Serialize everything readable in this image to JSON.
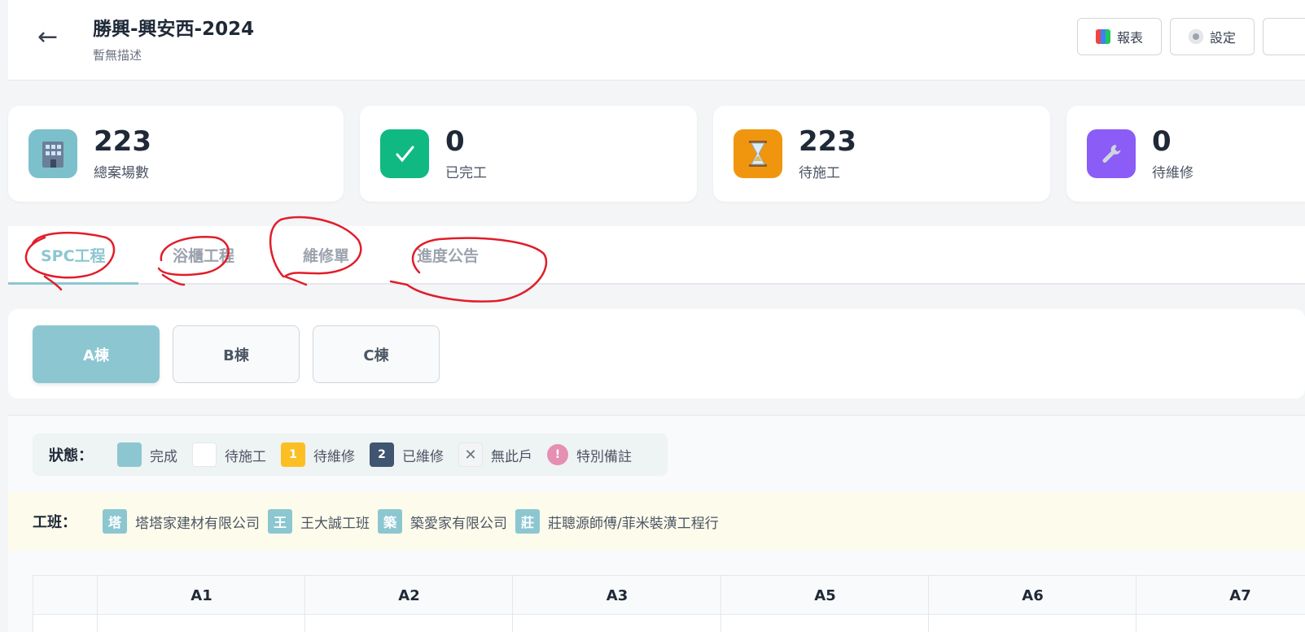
{
  "header": {
    "back_icon": "←",
    "title": "勝興-興安西-2024",
    "subtitle": "暫無描述",
    "buttons": [
      {
        "label": "報表",
        "icon": "report-icon"
      },
      {
        "label": "設定",
        "icon": "gear-icon"
      }
    ]
  },
  "stats": [
    {
      "value": "223",
      "label": "總案場數",
      "icon": "building-icon",
      "color": "#7cc0cb"
    },
    {
      "value": "0",
      "label": "已完工",
      "icon": "check-icon",
      "color": "#10b981"
    },
    {
      "value": "223",
      "label": "待施工",
      "icon": "hourglass-icon",
      "color": "#f59e0b"
    },
    {
      "value": "0",
      "label": "待維修",
      "icon": "wrench-icon",
      "color": "#8b5cf6"
    }
  ],
  "tabs": [
    {
      "label": "SPC工程",
      "active": true
    },
    {
      "label": "浴櫃工程",
      "active": false
    },
    {
      "label": "維修單",
      "active": false
    },
    {
      "label": "進度公告",
      "active": false
    }
  ],
  "buildings": [
    {
      "label": "A棟",
      "active": true
    },
    {
      "label": "B棟",
      "active": false
    },
    {
      "label": "C棟",
      "active": false
    }
  ],
  "legend": {
    "title": "狀態：",
    "items": [
      {
        "label": "完成",
        "color": "#8cc7d1",
        "mark": ""
      },
      {
        "label": "待施工",
        "color": "#ffffff",
        "mark": ""
      },
      {
        "label": "待維修",
        "color": "#fbbf24",
        "mark": "1"
      },
      {
        "label": "已維修",
        "color": "#3f5570",
        "mark": "2"
      },
      {
        "label": "無此戶",
        "color": "#f3f4f6",
        "mark": "✕"
      },
      {
        "label": "特別備註",
        "color": "#e58fb2",
        "mark": "!"
      }
    ]
  },
  "teams": {
    "title": "工班：",
    "items": [
      {
        "badge": "塔",
        "name": "塔塔家建材有限公司"
      },
      {
        "badge": "王",
        "name": "王大誠工班"
      },
      {
        "badge": "築",
        "name": "築愛家有限公司"
      },
      {
        "badge": "莊",
        "name": "莊聰源師傅/菲米裝潢工程行"
      }
    ]
  },
  "grid": {
    "columns": [
      "A1",
      "A2",
      "A3",
      "A5",
      "A6",
      "A7"
    ]
  }
}
